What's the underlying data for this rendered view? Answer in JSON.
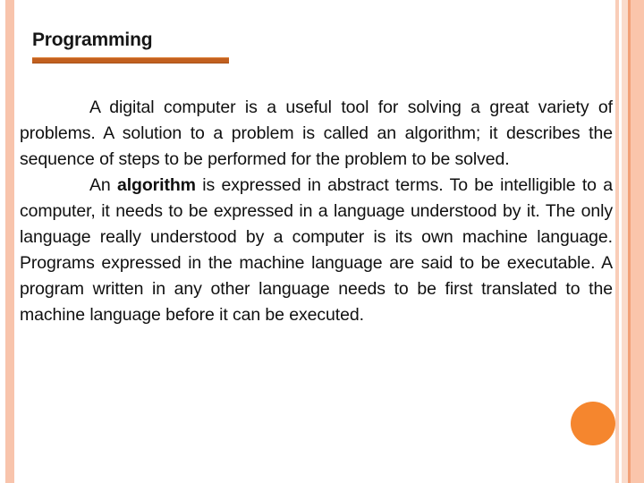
{
  "slide": {
    "title": "Programming",
    "paragraphs": [
      {
        "id": "p1",
        "lead": "A digital computer is a useful tool for solving a great variety of problems. A solution to a problem is called an algorithm; it describes the sequence of steps to be performed for the problem to be solved."
      },
      {
        "id": "p2",
        "before_bold": "An ",
        "bold": "algorithm",
        "after_bold": " is expressed in abstract terms. To be intelligible to a computer, it needs to be expressed in a language understood by it. The only language really understood by a computer is its own machine language. Programs expressed in the machine language are said to be executable. A program written in any other language needs to be first translated to the machine language before it can be executed."
      }
    ]
  },
  "theme": {
    "accent_rule": "#C2601F",
    "accent_dot": "#F5862E",
    "stripe_light": "#FAC5AB",
    "stripe_pale": "#FADBCB",
    "stripe_dark": "#F2A077",
    "title_color": "#161616",
    "body_color": "#101010",
    "background": "#FFFFFF"
  }
}
